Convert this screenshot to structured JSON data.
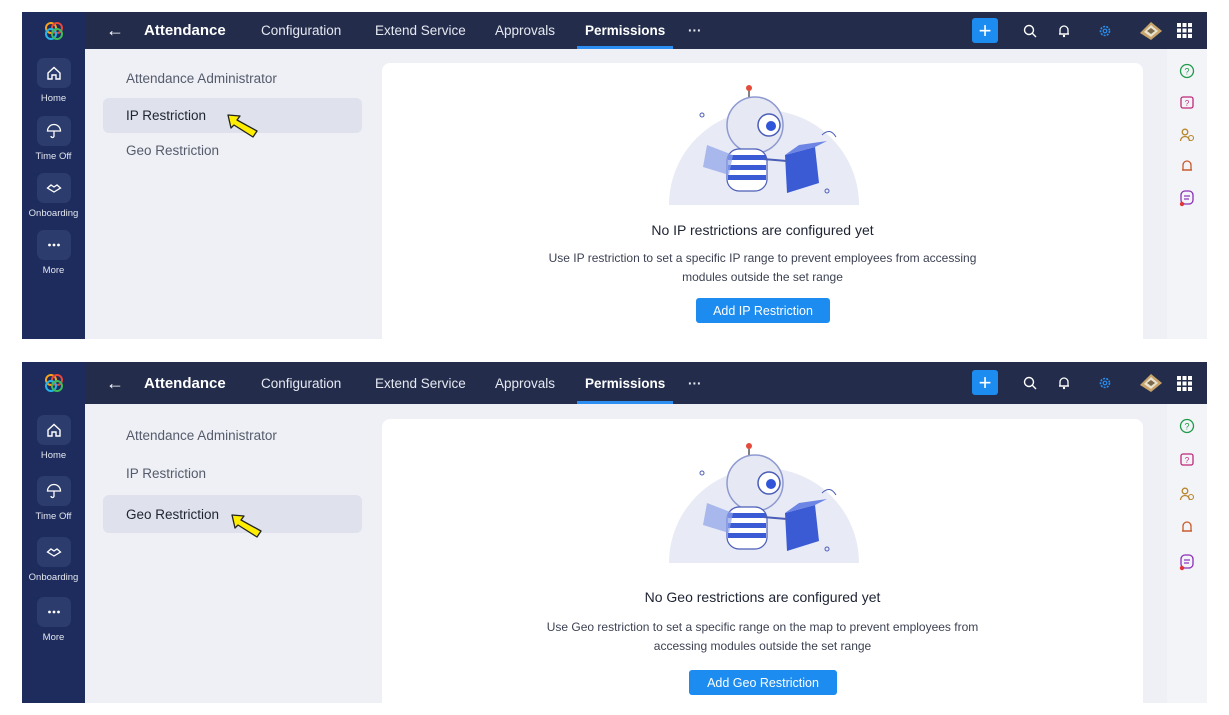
{
  "colors": {
    "topbar": "#232d4b",
    "sidebar": "#1d2c5c",
    "accent": "#1d8cf0",
    "pointer": "#ffee00"
  },
  "icons": {
    "back": "arrow-left-icon",
    "plus": "plus-icon",
    "search": "search-icon",
    "bell": "bell-icon",
    "settings": "gear-icon",
    "grid": "apps-grid-icon"
  },
  "panels": [
    {
      "header": {
        "back_label": "←",
        "title": "Attendance",
        "tabs": [
          {
            "label": "Configuration"
          },
          {
            "label": "Extend Service"
          },
          {
            "label": "Approvals"
          },
          {
            "label": "Permissions"
          },
          {
            "label": "···"
          }
        ],
        "plus_label": "+"
      },
      "sidebar": {
        "items": [
          {
            "label": "Home"
          },
          {
            "label": "Time Off"
          },
          {
            "label": "Onboarding"
          },
          {
            "label": "More"
          }
        ]
      },
      "submenu": {
        "items": [
          {
            "label": "Attendance Administrator"
          },
          {
            "label": "IP Restriction"
          },
          {
            "label": "Geo Restriction"
          }
        ],
        "selected": "IP Restriction"
      },
      "empty_state": {
        "title": "No IP restrictions are configured yet",
        "description": "Use IP restriction to set a specific IP range to prevent employees from accessing modules outside the set range",
        "button_label": "Add IP Restriction"
      }
    },
    {
      "header": {
        "back_label": "←",
        "title": "Attendance",
        "tabs": [
          {
            "label": "Configuration"
          },
          {
            "label": "Extend Service"
          },
          {
            "label": "Approvals"
          },
          {
            "label": "Permissions"
          },
          {
            "label": "···"
          }
        ],
        "plus_label": "+"
      },
      "sidebar": {
        "items": [
          {
            "label": "Home"
          },
          {
            "label": "Time Off"
          },
          {
            "label": "Onboarding"
          },
          {
            "label": "More"
          }
        ]
      },
      "submenu": {
        "items": [
          {
            "label": "Attendance Administrator"
          },
          {
            "label": "IP Restriction"
          },
          {
            "label": "Geo Restriction"
          }
        ],
        "selected": "Geo Restriction"
      },
      "empty_state": {
        "title": "No Geo restrictions are configured yet",
        "description": "Use Geo restriction to set a specific range on the map to prevent employees from accessing modules outside the set range",
        "button_label": "Add Geo Restriction"
      }
    }
  ]
}
